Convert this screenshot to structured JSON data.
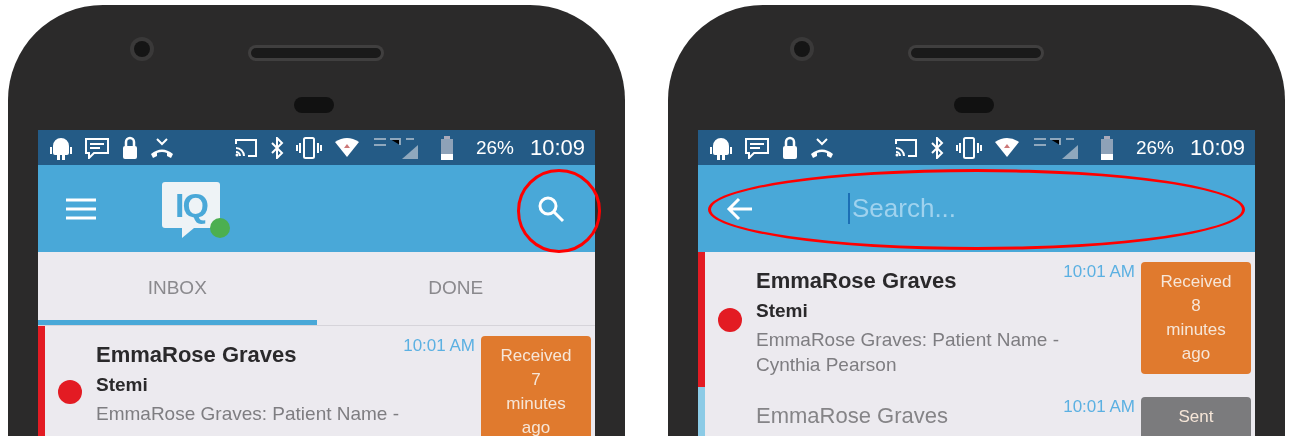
{
  "phones": [
    {
      "status_bar": {
        "battery": "26%",
        "time": "10:09"
      },
      "app_bar": {
        "kind": "main",
        "logo_text": "IQ",
        "highlight": {
          "kind": "circle"
        }
      },
      "tabs": [
        {
          "label": "INBOX",
          "selected": true
        },
        {
          "label": "DONE",
          "selected": false
        }
      ],
      "messages": [
        {
          "sender": "EmmaRose Graves",
          "subject": "Stemi",
          "preview": "EmmaRose Graves: Patient Name -",
          "time": "10:01 AM",
          "unread": true,
          "color": "#e31b23",
          "badge": {
            "kind": "received",
            "lines": [
              "Received",
              "7",
              "minutes",
              "ago"
            ]
          }
        }
      ]
    },
    {
      "status_bar": {
        "battery": "26%",
        "time": "10:09"
      },
      "app_bar": {
        "kind": "search",
        "placeholder": "Search...",
        "highlight": {
          "kind": "ellipse"
        }
      },
      "messages": [
        {
          "sender": "EmmaRose Graves",
          "subject": "Stemi",
          "preview": "EmmaRose Graves: Patient Name - Cynthia Pearson",
          "time": "10:01 AM",
          "unread": true,
          "color": "#e31b23",
          "badge": {
            "kind": "received",
            "lines": [
              "Received",
              "8",
              "minutes",
              "ago"
            ]
          }
        },
        {
          "sender": "EmmaRose Graves",
          "time": "10:01 AM",
          "unread": false,
          "color": "#8ccbe6",
          "badge": {
            "kind": "sent",
            "lines": [
              "Sent"
            ]
          }
        }
      ]
    }
  ]
}
